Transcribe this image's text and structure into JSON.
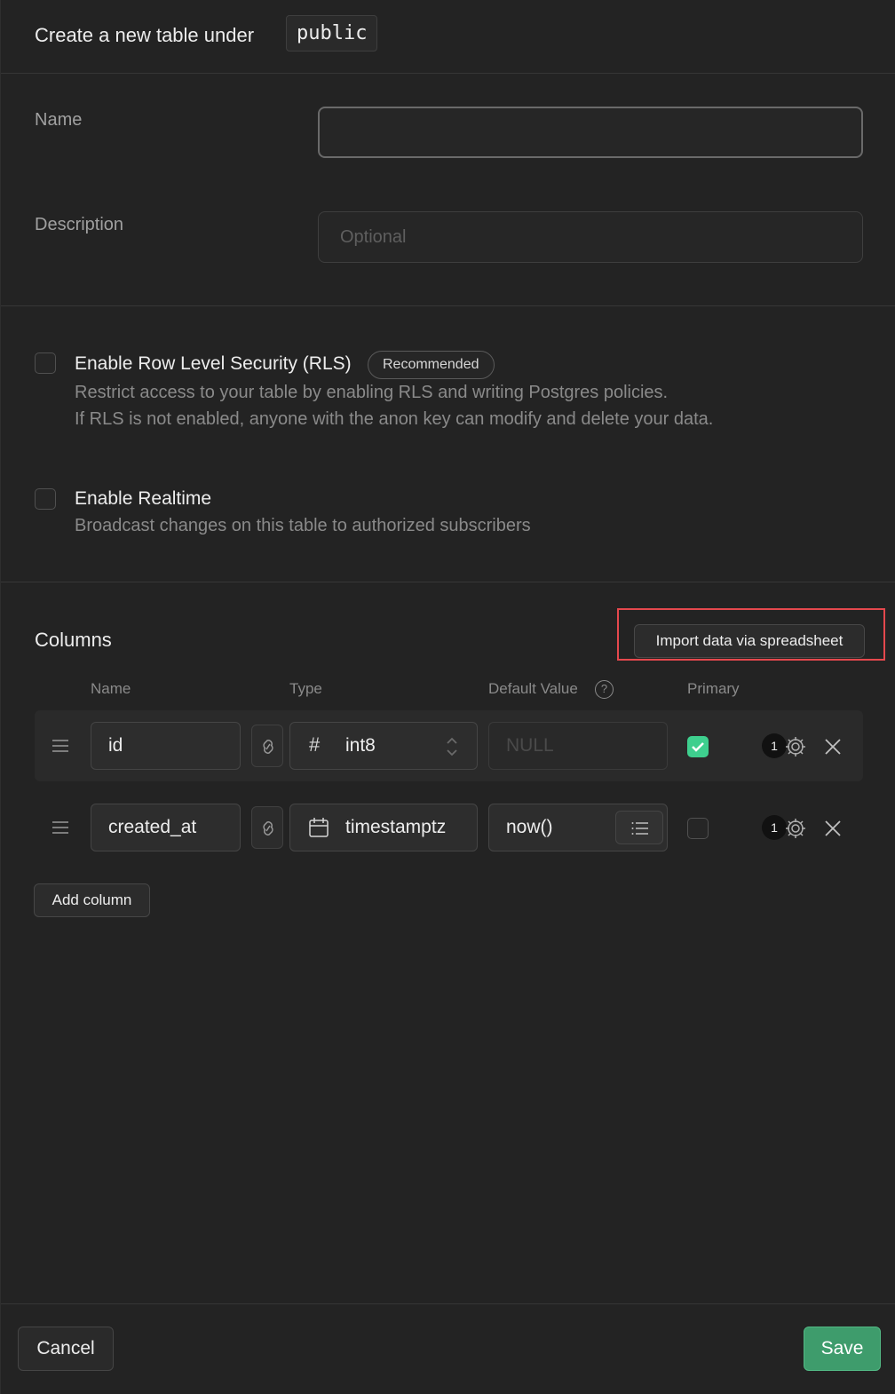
{
  "header": {
    "title": "Create a new table under",
    "schema": "public"
  },
  "form": {
    "name_label": "Name",
    "name_value": "",
    "description_label": "Description",
    "description_placeholder": "Optional"
  },
  "rls": {
    "title": "Enable Row Level Security (RLS)",
    "badge": "Recommended",
    "desc_line1": "Restrict access to your table by enabling RLS and writing Postgres policies.",
    "desc_line2": "If RLS is not enabled, anyone with the anon key can modify and delete your data.",
    "checked": false
  },
  "realtime": {
    "title": "Enable Realtime",
    "desc": "Broadcast changes on this table to authorized subscribers",
    "checked": false
  },
  "columns": {
    "title": "Columns",
    "import_label": "Import data via spreadsheet",
    "headers": {
      "name": "Name",
      "type": "Type",
      "default": "Default Value",
      "primary": "Primary"
    },
    "help_glyph": "?",
    "rows": [
      {
        "name": "id",
        "type_icon": "hash-icon",
        "type": "int8",
        "default": "NULL",
        "primary": true,
        "settings_count": "1"
      },
      {
        "name": "created_at",
        "type_icon": "calendar-icon",
        "type": "timestamptz",
        "default": "now()",
        "primary": false,
        "settings_count": "1"
      }
    ],
    "add_label": "Add column"
  },
  "footer": {
    "cancel_label": "Cancel",
    "save_label": "Save"
  },
  "colors": {
    "accent": "#3ecf8e",
    "highlight": "#e5484d",
    "background": "#232323"
  }
}
